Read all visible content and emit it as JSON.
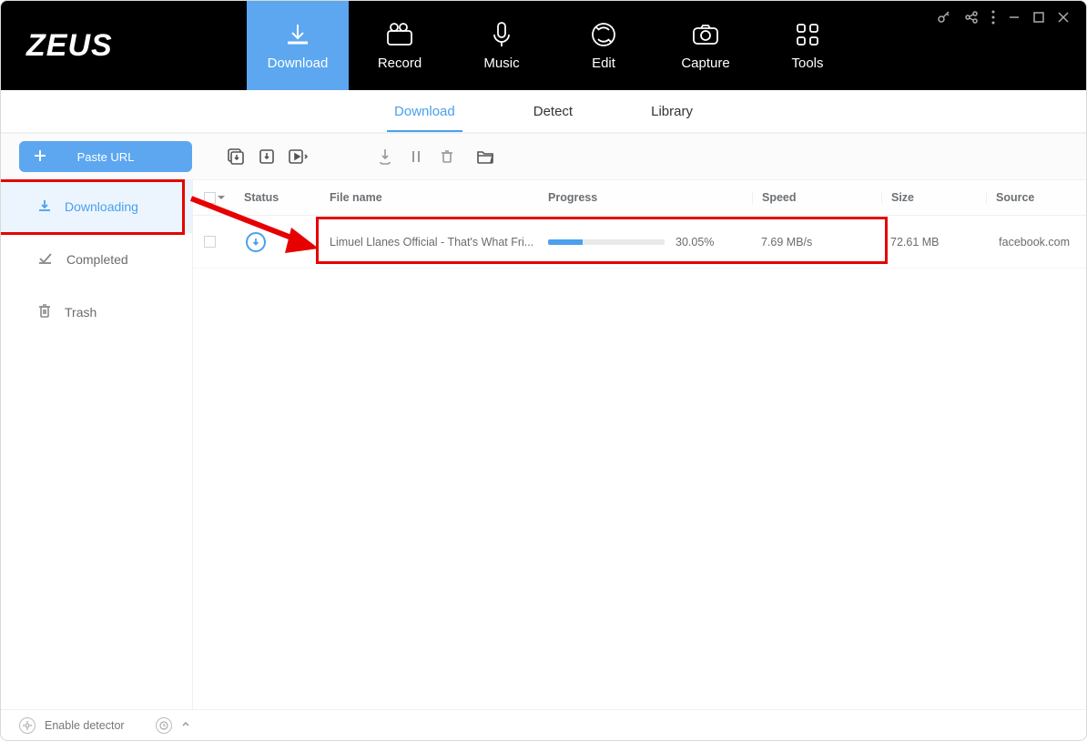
{
  "app": {
    "logo": "ZEUS"
  },
  "nav_tabs": [
    {
      "label": "Download",
      "icon": "download"
    },
    {
      "label": "Record",
      "icon": "record"
    },
    {
      "label": "Music",
      "icon": "music"
    },
    {
      "label": "Edit",
      "icon": "edit"
    },
    {
      "label": "Capture",
      "icon": "capture"
    },
    {
      "label": "Tools",
      "icon": "tools"
    }
  ],
  "subnav": [
    {
      "label": "Download",
      "active": true
    },
    {
      "label": "Detect"
    },
    {
      "label": "Library"
    }
  ],
  "toolbar": {
    "paste_url": "Paste URL"
  },
  "sidebar": {
    "downloading": "Downloading",
    "completed": "Completed",
    "trash": "Trash"
  },
  "table": {
    "headers": {
      "status": "Status",
      "filename": "File name",
      "progress": "Progress",
      "speed": "Speed",
      "size": "Size",
      "source": "Source"
    },
    "rows": [
      {
        "status": "downloading",
        "filename": "Limuel Llanes Official - That's What Fri...",
        "progress_pct": 30.05,
        "progress_text": "30.05%",
        "speed": "7.69 MB/s",
        "size": "72.61 MB",
        "source": "facebook.com"
      }
    ]
  },
  "footer": {
    "detector": "Enable detector"
  }
}
